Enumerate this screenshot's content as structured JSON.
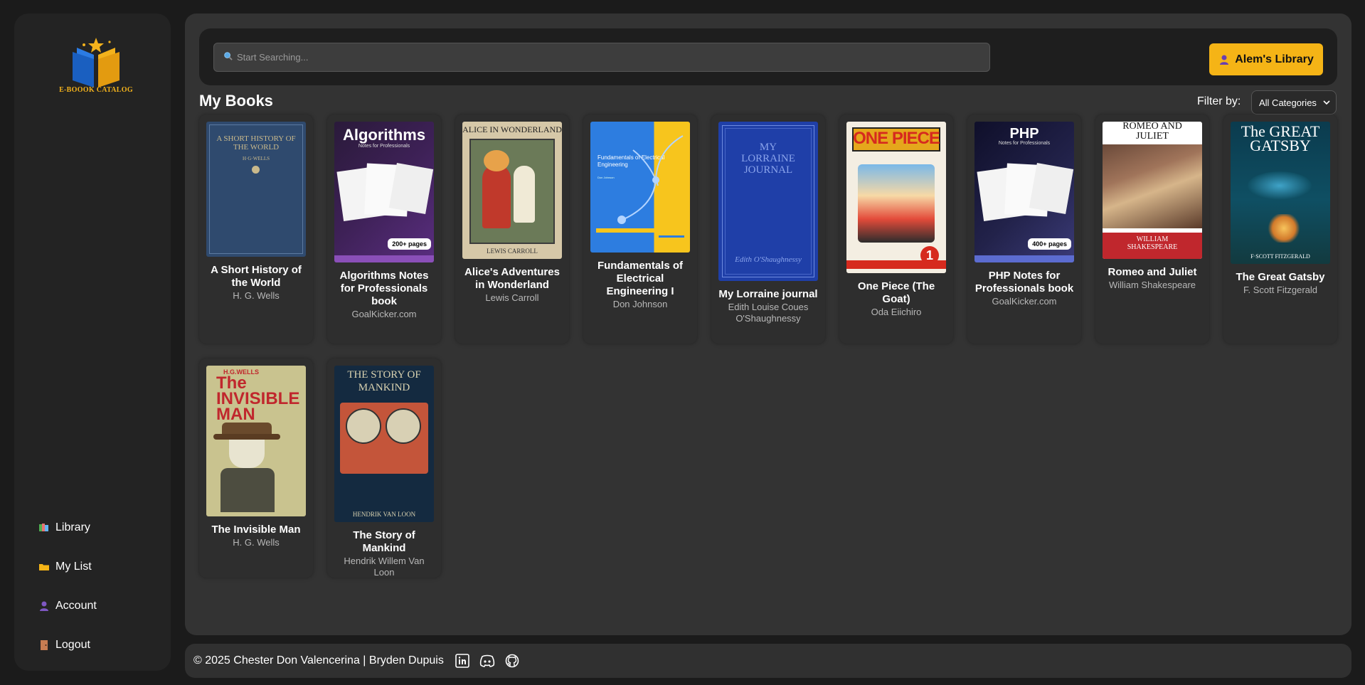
{
  "app": {
    "logo_text": "E-BOOOK CATALOG",
    "accent_color": "#f5b416"
  },
  "sidebar": {
    "items": [
      {
        "label": "Library",
        "icon": "books-icon"
      },
      {
        "label": "My List",
        "icon": "folder-icon"
      },
      {
        "label": "Account",
        "icon": "user-icon"
      },
      {
        "label": "Logout",
        "icon": "door-icon"
      }
    ]
  },
  "header": {
    "search_placeholder": "Start Searching...",
    "user_button": "Alem's Library"
  },
  "main": {
    "title": "My Books",
    "filter_label": "Filter by:",
    "filter_value": "All Categories"
  },
  "books": [
    {
      "title": "A Short History of the World",
      "author": "H. G. Wells",
      "cover_text": "A SHORT HISTORY OF THE WORLD",
      "cover_sub": "H·G·WELLS"
    },
    {
      "title": "Algorithms Notes for Professionals book",
      "author": "GoalKicker.com",
      "cover_text": "Algorithms",
      "cover_sub": "Notes for Professionals",
      "badge": "200+ pages"
    },
    {
      "title": "Alice's Adventures in Wonderland",
      "author": "Lewis Carroll",
      "cover_text": "ALICE IN WONDERLAND",
      "cover_sub": "LEWIS CARROLL"
    },
    {
      "title": "Fundamentals of Electrical Engineering I",
      "author": "Don Johnson",
      "cover_text": "Fundamentals of Electrical Engineering",
      "cover_sub": "Don Johnson"
    },
    {
      "title": "My Lorraine journal",
      "author": "Edith Louise Coues O'Shaughnessy",
      "cover_text": "MY LORRAINE JOURNAL",
      "cover_sub": "Edith O'Shaughnessy"
    },
    {
      "title": "One Piece (The Goat)",
      "author": "Oda Eiichiro",
      "cover_text": "ONE PIECE",
      "cover_sub": "1"
    },
    {
      "title": "PHP Notes for Professionals book",
      "author": "GoalKicker.com",
      "cover_text": "PHP",
      "cover_sub": "Notes for Professionals",
      "badge": "400+ pages"
    },
    {
      "title": "Romeo and Juliet",
      "author": "William Shakespeare",
      "cover_text": "ROMEO AND JULIET",
      "cover_sub": "WILLIAM SHAKESPEARE"
    },
    {
      "title": "The Great Gatsby",
      "author": "F. Scott Fitzgerald",
      "cover_text": "The GREAT GATSBY",
      "cover_sub": "F·SCOTT FITZGERALD"
    },
    {
      "title": "The Invisible Man",
      "author": "H. G. Wells",
      "cover_text": "The INVISIBLE MAN",
      "cover_sub": "H.G.WELLS"
    },
    {
      "title": "The Story of Mankind",
      "author": "Hendrik Willem Van Loon",
      "cover_text": "THE STORY OF MANKIND",
      "cover_sub": "HENDRIK VAN LOON"
    }
  ],
  "footer": {
    "text": "© 2025 Chester Don Valencerina | Bryden Dupuis",
    "social_icons": [
      "linkedin-icon",
      "discord-icon",
      "github-icon"
    ]
  }
}
